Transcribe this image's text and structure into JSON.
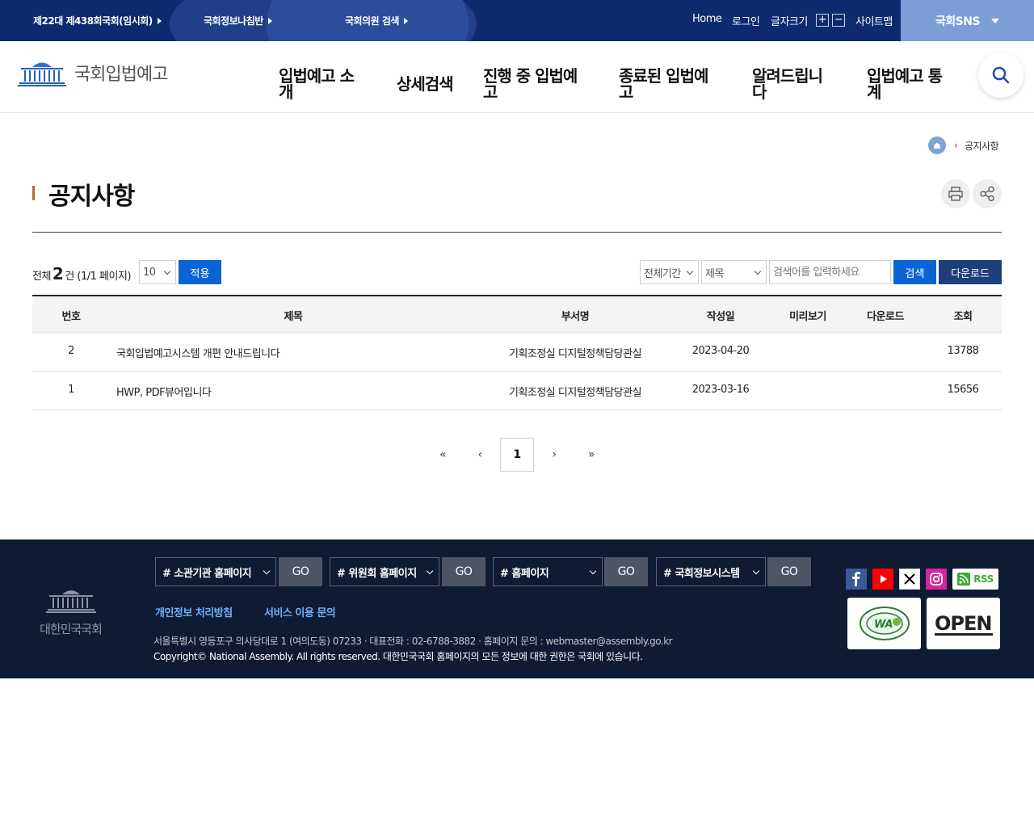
{
  "topbar": {
    "links": [
      {
        "label": "제22대 제438회국회(임시회)"
      },
      {
        "label": "국회정보나침반"
      },
      {
        "label": "국회의원 검색"
      }
    ],
    "home": "Home",
    "login": "로그인",
    "font_size": "글자크기",
    "font_plus": "+",
    "font_minus": "−",
    "sitemap": "사이트맵",
    "sns": "국회SNS"
  },
  "header": {
    "logo_text": "국회입법예고",
    "nav": [
      {
        "line1": "입법예고 소",
        "line2": "개"
      },
      {
        "line1": "상세검색",
        "line2": ""
      },
      {
        "line1": "진행 중 입법예",
        "line2": "고"
      },
      {
        "line1": "종료된 입법예",
        "line2": "고"
      },
      {
        "line1": "알려드립니",
        "line2": "다"
      },
      {
        "line1": "입법예고 통",
        "line2": "계"
      }
    ]
  },
  "breadcrumb": {
    "separator": "›",
    "current": "공지사항"
  },
  "page": {
    "title": "공지사항"
  },
  "toolbar": {
    "total_prefix": "전체",
    "total_count": "2",
    "total_suffix": "건 (1/1 페이지)",
    "page_size": "10",
    "apply": "적용",
    "period": "전체기간",
    "field": "제목",
    "search_placeholder": "검색어를 입력하세요",
    "search": "검색",
    "download": "다운로드"
  },
  "table": {
    "headers": [
      "번호",
      "제목",
      "부서명",
      "작성일",
      "미리보기",
      "다운로드",
      "조회"
    ],
    "rows": [
      {
        "no": "2",
        "title": "국회입법예고시스템 개편 안내드립니다",
        "dept": "기획조정실 디지털정책담당관실",
        "date": "2023-04-20",
        "views": "13788"
      },
      {
        "no": "1",
        "title": "HWP, PDF뷰어입니다",
        "dept": "기획조정실 디지털정책담당관실",
        "date": "2023-03-16",
        "views": "15656"
      }
    ]
  },
  "pagination": {
    "first": "«",
    "prev": "‹",
    "current": "1",
    "next": "›",
    "last": "»"
  },
  "footer": {
    "logo_text": "대한민국국회",
    "selects": [
      "# 소관기관 홈페이지",
      "# 위원회 홈페이지",
      "# 홈페이지",
      "# 국회정보시스템"
    ],
    "go": "GO",
    "privacy": "개인정보 처리방침",
    "inquiry": "서비스 이용 문의",
    "address": "서울특별시 영등포구 의사당대로 1 (여의도동) 07233 · 대표전화 : 02-6788-3882 · 홈페이지 문의 : webmaster@assembly.go.kr",
    "copyright": "Copyright© National Assembly. All rights reserved. 대한민국국회 홈페이지의 모든 정보에 대한 권한은 국회에 있습니다.",
    "rss": "RSS",
    "open_badge": "OPEN",
    "wa_badge": "WA"
  },
  "colors": {
    "topbar": "#0d2a6e",
    "sns_bar": "#7b9ed6",
    "primary_button": "#0a64d6",
    "navy_button": "#1f3f7a",
    "footer": "#0f1a33",
    "footer_link": "#6db1ff",
    "title_accent": "#a8732b"
  }
}
